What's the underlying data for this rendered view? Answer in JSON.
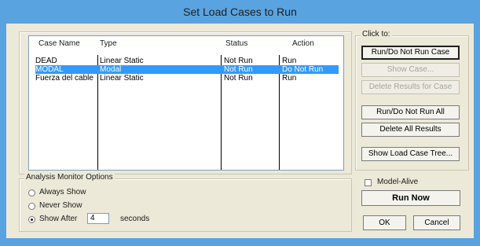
{
  "window": {
    "title": "Set Load Cases to Run"
  },
  "cases": {
    "headers": {
      "name": "Case Name",
      "type": "Type",
      "status": "Status",
      "action": "Action"
    },
    "rows": [
      {
        "name": "DEAD",
        "type": "Linear Static",
        "status": "Not Run",
        "action": "Run",
        "selected": false
      },
      {
        "name": "MODAL",
        "type": "Modal",
        "status": "Not Run",
        "action": "Do Not Run",
        "selected": true
      },
      {
        "name": "Fuerza del cable",
        "type": "Linear Static",
        "status": "Not Run",
        "action": "Run",
        "selected": false
      }
    ]
  },
  "click_to": {
    "legend": "Click to:",
    "run_toggle": "Run/Do Not Run Case",
    "show_case": "Show Case...",
    "delete_results_case": "Delete Results for Case",
    "run_toggle_all": "Run/Do Not Run All",
    "delete_all": "Delete All Results",
    "show_tree": "Show Load Case Tree..."
  },
  "monitor": {
    "legend": "Analysis Monitor Options",
    "always_show": "Always Show",
    "never_show": "Never Show",
    "show_after": "Show After",
    "seconds_value": "4",
    "seconds_label": "seconds",
    "selected_option": "show_after"
  },
  "bottom": {
    "model_alive": "Model-Alive",
    "model_alive_checked": false,
    "run_now": "Run Now",
    "ok": "OK",
    "cancel": "Cancel"
  }
}
